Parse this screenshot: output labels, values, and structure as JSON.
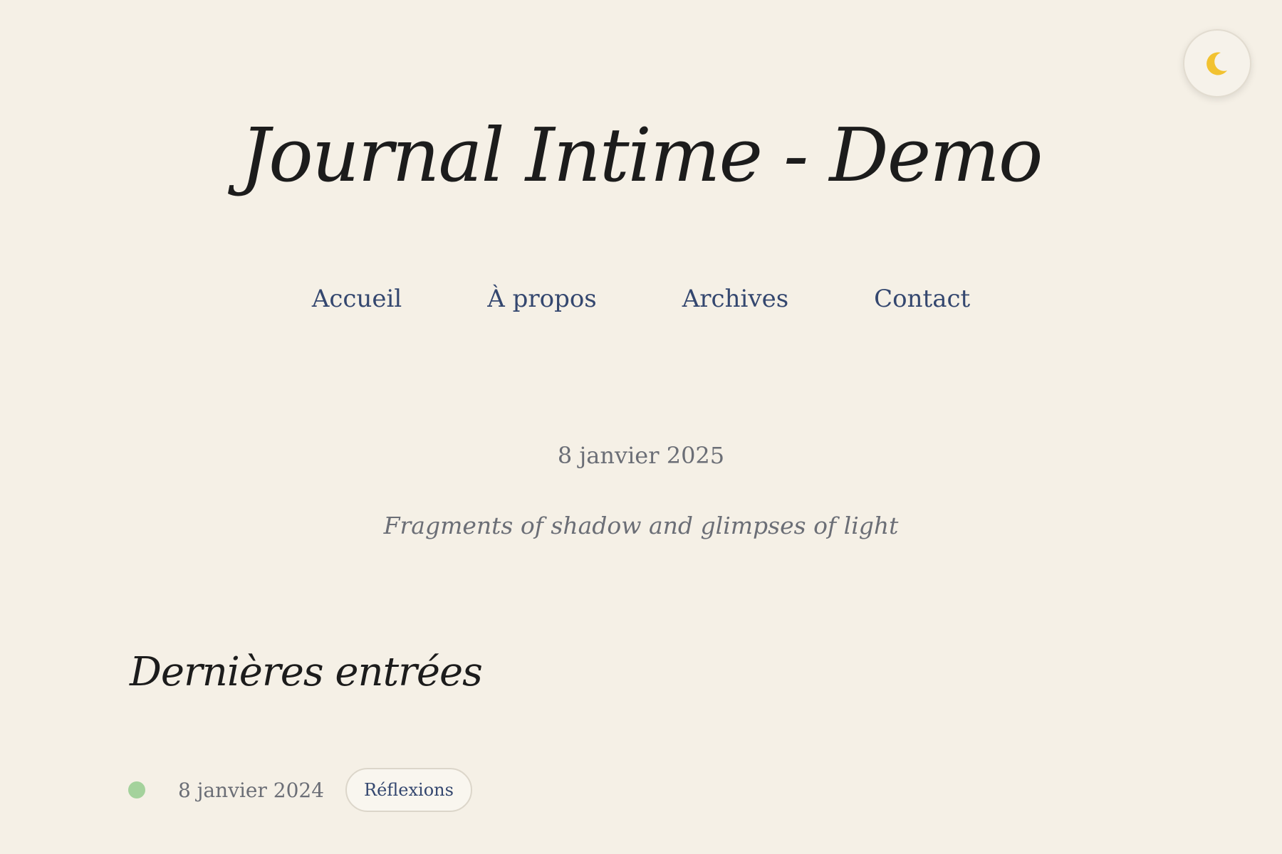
{
  "theme_toggle": {
    "icon": "crescent-moon-icon",
    "icon_color": "#f2c230"
  },
  "header": {
    "title": "Journal Intime - Demo",
    "nav": [
      "Accueil",
      "À propos",
      "Archives",
      "Contact"
    ]
  },
  "intro": {
    "date": "8 janvier 2025",
    "tagline": "Fragments of shadow and glimpses of light"
  },
  "latest": {
    "heading": "Dernières entrées",
    "entries": [
      {
        "date": "8 janvier 2024",
        "tag": "Réflexions",
        "title": "",
        "status_color": "#a4d29c"
      }
    ]
  },
  "colors": {
    "background": "#f5f0e6",
    "link": "#34476f",
    "muted_text": "#6b6e76",
    "heading_text": "#1c1c1c"
  }
}
